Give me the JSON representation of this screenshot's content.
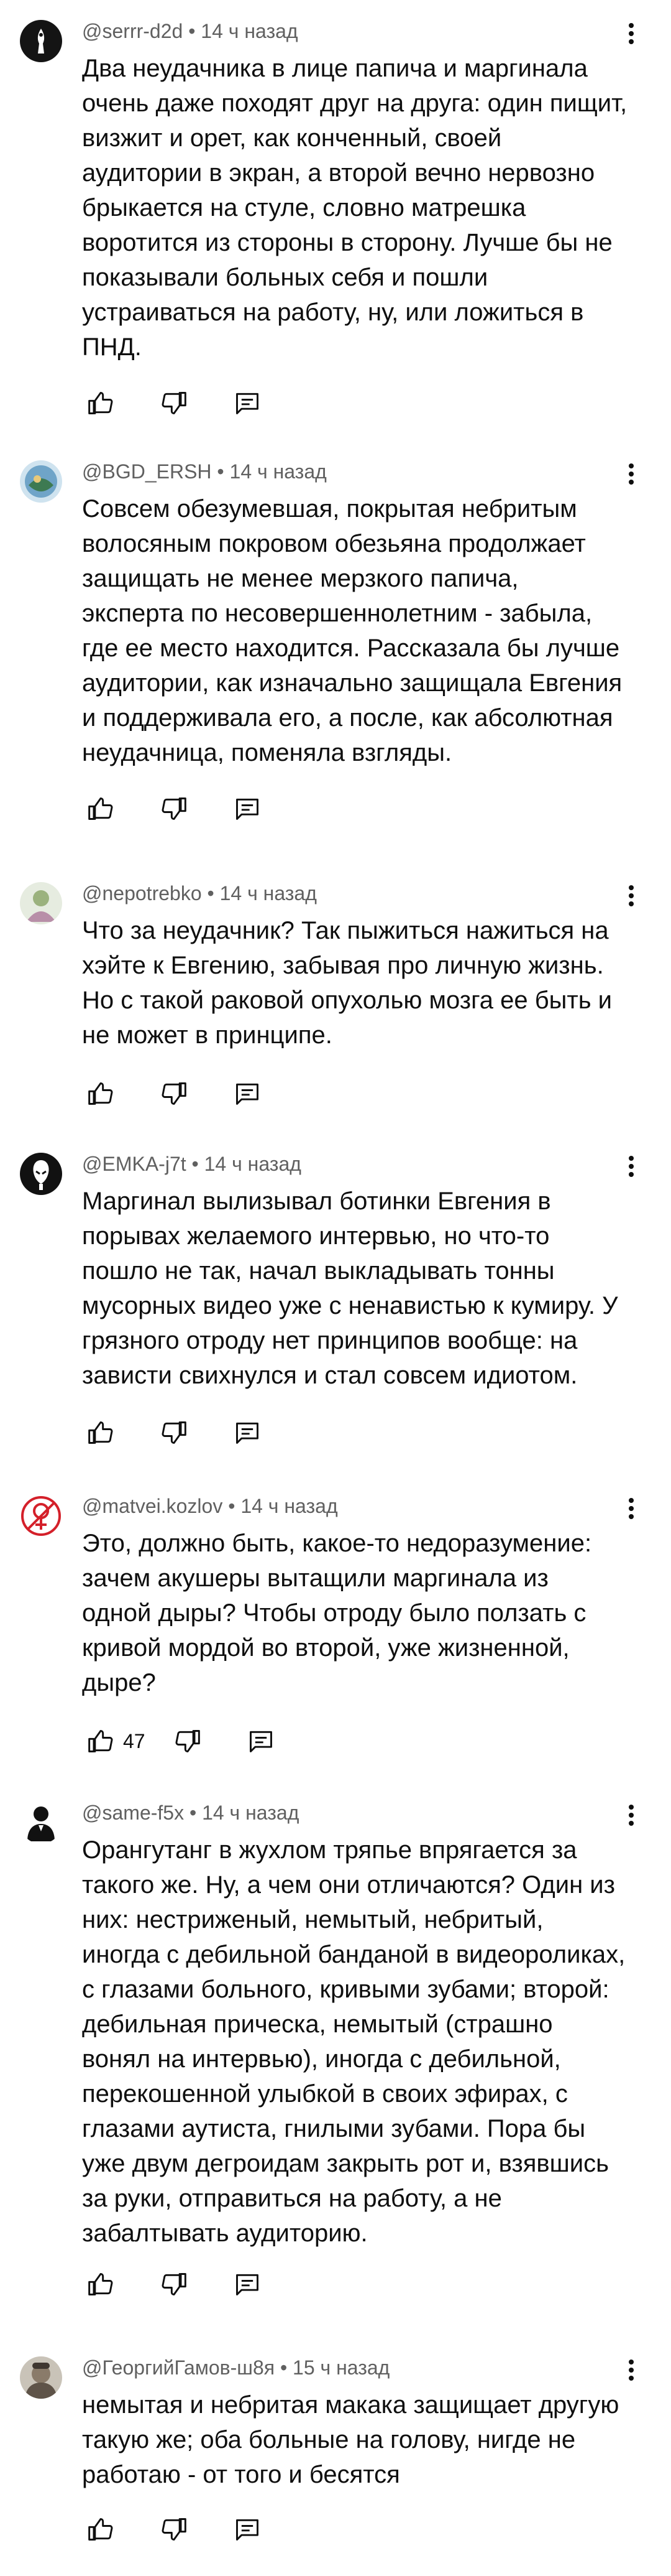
{
  "comments": [
    {
      "author": "@serrr-d2d",
      "time": "14 ч назад",
      "text": "Два неудачника в лице папича и маргинала\nочень даже походят друг на друга: один пищит,\nвизжит и орет, как конченный, своей\nаудитории в экран, а второй вечно нервозно\nбрыкается на стуле, словно матрешка\nворотится из стороны в сторону. Лучше бы не\nпоказывали больных себя и пошли\nустраиваться на работу, ну, или ложиться в\nПНД.",
      "likes": ""
    },
    {
      "author": "@BGD_ERSH",
      "time": "14 ч назад",
      "text": "Совсем обезумевшая, покрытая небритым\nволосяным покровом обезьяна продолжает\nзащищать не менее мерзкого папича,\nэксперта по несовершеннолетним - забыла,\nгде ее место находится. Рассказала бы лучше\nаудитории, как изначально защищала Евгения\nи поддерживала его, а после, как абсолютная\nнеудачница, поменяла взгляды.",
      "likes": ""
    },
    {
      "author": "@nepotrebko",
      "time": "14 ч назад",
      "text": "Что за неудачник? Так пыжиться нажиться на\nхэйте к Евгению, забывая про личную жизнь.\nНо с такой раковой опухолью мозга ее быть и\nне может в принципе.",
      "likes": ""
    },
    {
      "author": "@EMKA-j7t",
      "time": "14 ч назад",
      "text": "Маргинал вылизывал ботинки Евгения в\nпорывах желаемого интервью, но что-то\nпошло не так, начал выкладывать тонны\nмусорных видео уже с ненавистью к кумиру. У\nгрязного отроду нет принципов вообще: на\nзависти свихнулся и стал совсем идиотом.",
      "likes": ""
    },
    {
      "author": "@matvei.kozlov",
      "time": "14 ч назад",
      "text": "Это, должно быть, какое-то недоразумение:\nзачем акушеры вытащили маргинала из\nодной дыры? Чтобы отроду было ползать с\nкривой мордой во второй, уже жизненной,\nдыре?",
      "likes": "47"
    },
    {
      "author": "@same-f5x",
      "time": "14 ч назад",
      "text": "Орангутанг в жухлом тряпье впрягается за\nтакого же. Ну, а чем они отличаются? Один из\nних: нестриженый, немытый, небритый,\nиногда с дебильной банданой в видеороликах,\nс глазами больного, кривыми зубами; второй:\nдебильная прическа, немытый (страшно\nвонял на интервью), иногда с дебильной,\nперекошенной улыбкой в своих эфирах, с\nглазами аутиста, гнилыми зубами. Пора бы\nуже двум дегроидам закрыть рот и, взявшись\nза руки, отправиться на работу, а не\nзабалтывать аудиторию.",
      "likes": ""
    },
    {
      "author": "@ГеоргийГамов-ш8я",
      "time": "15 ч назад",
      "text": "немытая и небритая макака защищает другую\nтакую же; оба больные на голову, нигде не\nработаю - от того и бесятся",
      "likes": ""
    }
  ],
  "separator": " • "
}
